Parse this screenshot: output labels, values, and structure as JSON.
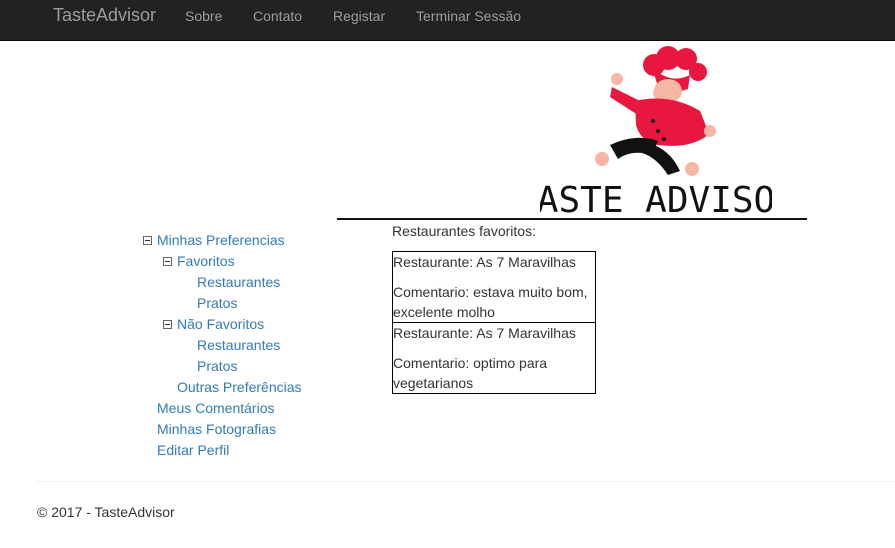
{
  "navbar": {
    "brand": "TasteAdvisor",
    "links": [
      "Sobre",
      "Contato",
      "Registar",
      "Terminar Sessão"
    ]
  },
  "logo": {
    "text": "TASTE ADVISOR"
  },
  "sidebar": {
    "root": "Minhas Preferencias",
    "favoritos": "Favoritos",
    "favoritos_items": [
      "Restaurantes",
      "Pratos"
    ],
    "nao_favoritos": "Não Favoritos",
    "nao_favoritos_items": [
      "Restaurantes",
      "Pratos"
    ],
    "outras": "Outras Preferências",
    "extra_links": [
      "Meus Comentários",
      "Minhas Fotografias",
      "Editar Perfil"
    ]
  },
  "main": {
    "title": "Restaurantes favoritos:",
    "cards": [
      {
        "restaurant": "Restaurante: As 7 Maravilhas",
        "comment_line1": "Comentario: estava muito bom,",
        "comment_line2": "excelente molho"
      },
      {
        "restaurant": "Restaurante: As 7 Maravilhas",
        "comment_line1": "Comentario: optimo para",
        "comment_line2": "vegetarianos"
      }
    ]
  },
  "footer": {
    "text": "© 2017 - TasteAdvisor"
  },
  "colors": {
    "navbar_bg": "#222222",
    "nav_text": "#9d9d9d",
    "link": "#337ab7",
    "chef_red": "#e8173f",
    "chef_skin": "#f7b5a4"
  }
}
